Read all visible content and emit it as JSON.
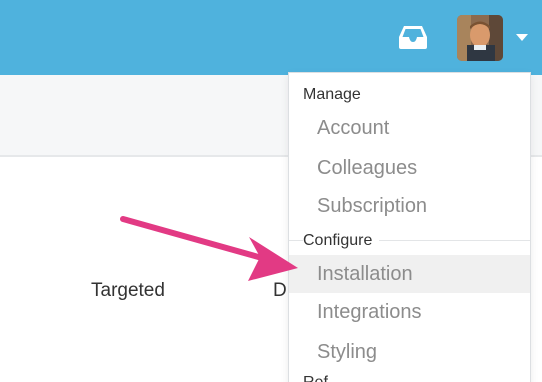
{
  "header": {
    "inbox_icon": "inbox-tray-icon",
    "avatar_icon": "user-avatar",
    "caret_icon": "caret-down-icon",
    "brand_color": "#4fb2dd"
  },
  "table": {
    "columns": [
      "Targeted",
      "D"
    ]
  },
  "menu": {
    "sections": [
      {
        "label": "Manage",
        "items": [
          "Account",
          "Colleagues",
          "Subscription"
        ]
      },
      {
        "label": "Configure",
        "items": [
          "Installation",
          "Integrations",
          "Styling"
        ]
      },
      {
        "label": "Ref"
      }
    ],
    "highlighted_item": "Installation"
  },
  "annotation": {
    "arrow_color": "#e23a84",
    "points_to": "Installation"
  }
}
